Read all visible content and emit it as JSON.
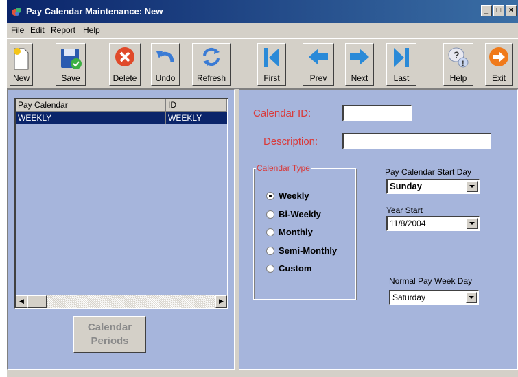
{
  "window": {
    "title": "Pay Calendar Maintenance: New"
  },
  "menu": [
    {
      "label": "File"
    },
    {
      "label": "Edit"
    },
    {
      "label": "Report"
    },
    {
      "label": "Help"
    }
  ],
  "toolbar": {
    "new_label": "New",
    "save_label": "Save",
    "delete_label": "Delete",
    "undo_label": "Undo",
    "refresh_label": "Refresh",
    "first_label": "First",
    "prev_label": "Prev",
    "next_label": "Next",
    "last_label": "Last",
    "help_label": "Help",
    "exit_label": "Exit"
  },
  "grid": {
    "columns": [
      "Pay Calendar",
      "ID"
    ],
    "rows": [
      {
        "pay_calendar": "WEEKLY",
        "id": "WEEKLY"
      }
    ]
  },
  "calendar_periods_label": "Calendar Periods",
  "form": {
    "calendar_id_label": "Calendar ID:",
    "calendar_id_value": "",
    "description_label": "Description:",
    "description_value": "",
    "calendar_type_label": "Calendar Type",
    "calendar_types": [
      {
        "label": "Weekly",
        "selected": true
      },
      {
        "label": "Bi-Weekly",
        "selected": false
      },
      {
        "label": "Monthly",
        "selected": false
      },
      {
        "label": "Semi-Monthly",
        "selected": false
      },
      {
        "label": "Custom",
        "selected": false
      }
    ],
    "start_day_label": "Pay Calendar  Start Day",
    "start_day_value": "Sunday",
    "year_start_label": "Year Start",
    "year_start_value": "11/8/2004",
    "normal_pay_day_label": "Normal Pay Week Day",
    "normal_pay_day_value": "Saturday"
  }
}
